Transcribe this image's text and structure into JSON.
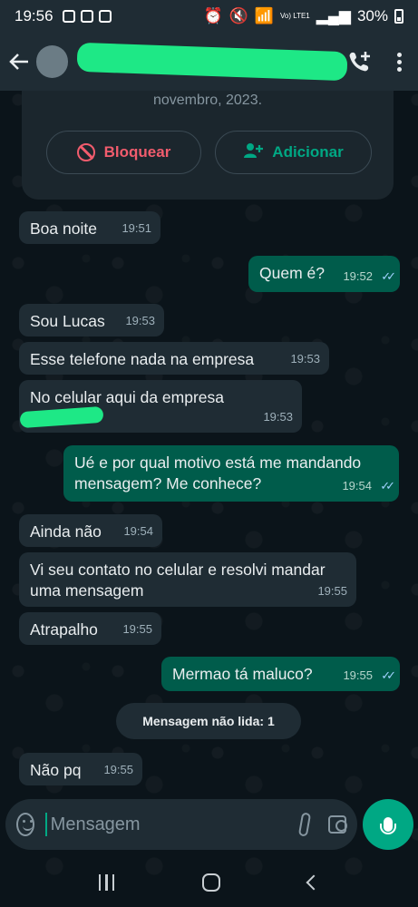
{
  "status_bar": {
    "time": "19:56",
    "network": "Vo) LTE1",
    "battery": "30%"
  },
  "header": {
    "contact_name": "",
    "icons": [
      "back-arrow-icon",
      "avatar",
      "add-call-icon",
      "more-options-icon"
    ]
  },
  "info_card": {
    "date_text": "novembro, 2023.",
    "block_label": "Bloquear",
    "add_label": "Adicionar"
  },
  "messages": [
    {
      "dir": "in",
      "text": "Boa noite",
      "time": "19:51"
    },
    {
      "dir": "out",
      "text": "Quem é?",
      "time": "19:52"
    },
    {
      "dir": "in",
      "text": "Sou Lucas",
      "time": "19:53"
    },
    {
      "dir": "in",
      "text": "Esse telefone nada na empresa",
      "time": "19:53"
    },
    {
      "dir": "in",
      "text": "No celular aqui da empresa",
      "time": "19:53"
    },
    {
      "dir": "out",
      "text": "Ué e por qual motivo está me mandando mensagem? Me conhece?",
      "time": "19:54"
    },
    {
      "dir": "in",
      "text": "Ainda não",
      "time": "19:54"
    },
    {
      "dir": "in",
      "text": "Vi seu contato no celular e resolvi mandar uma mensagem",
      "time": "19:55"
    },
    {
      "dir": "in",
      "text": "Atrapalho",
      "time": "19:55"
    },
    {
      "dir": "out",
      "text": "Mermao tá maluco?",
      "time": "19:55"
    },
    {
      "dir": "in",
      "text": "Não pq",
      "time": "19:55"
    }
  ],
  "unread_banner": "Mensagem não lida: 1",
  "input": {
    "placeholder": "Mensagem",
    "value": ""
  },
  "colors": {
    "background": "#0b141a",
    "incoming": "#1f2c34",
    "outgoing": "#005c4b",
    "accent": "#00a884",
    "block": "#f15c6d"
  }
}
